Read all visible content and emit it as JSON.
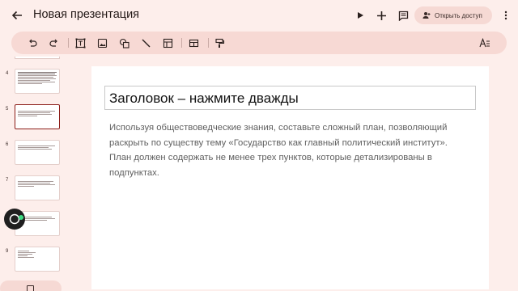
{
  "header": {
    "title": "Новая презентация",
    "share_label": "Открыть доступ"
  },
  "icons": {
    "back": "arrow-back-icon",
    "play": "play-icon",
    "add": "add-icon",
    "comments": "comment-icon",
    "share": "person-add-icon",
    "more": "more-vert-icon"
  },
  "toolbar": {
    "items": [
      "undo",
      "redo",
      "text-box",
      "image",
      "shapes",
      "line",
      "table",
      "layout",
      "paint-format",
      "text-format"
    ]
  },
  "filmstrip": {
    "slides": [
      {
        "number": "4"
      },
      {
        "number": "5",
        "selected": true
      },
      {
        "number": "6"
      },
      {
        "number": "7"
      },
      {
        "number": "8"
      },
      {
        "number": "9"
      }
    ]
  },
  "slide": {
    "title": "Заголовок – нажмите дважды",
    "body": "Используя обществоведческие знания, составьте сложный план, позволяющий раскрыть по существу тему «Государство как главный политический институт». План должен содержать не менее трех пунктов, которые детализированы в подпунктах."
  },
  "colors": {
    "background": "#fdeeeb",
    "toolbar": "#f7d9d4",
    "selected_border": "#8c1d18",
    "indicator": "#3ddc84"
  }
}
